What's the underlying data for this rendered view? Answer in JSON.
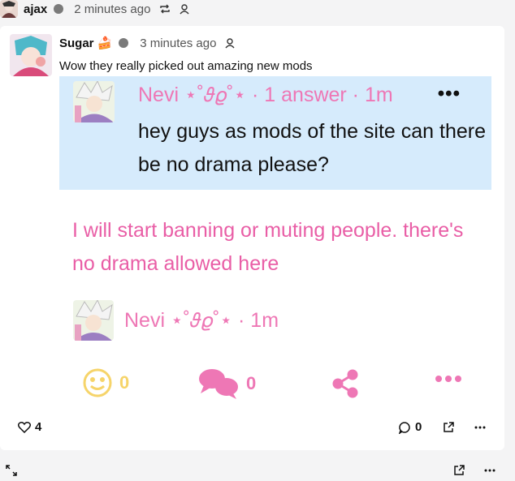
{
  "repost": {
    "author": "ajax",
    "time": "2 minutes ago"
  },
  "post": {
    "author": "Sugar",
    "author_emoji": "🍰",
    "time": "3 minutes ago",
    "text": "Wow they really picked out amazing new mods",
    "likes": "4",
    "comments": "0"
  },
  "embed": {
    "title": "Nevi ⋆˚𝜗𝜚˚⋆ · 1 answer · 1m",
    "question": "hey guys as mods of the site can there be no drama please?",
    "answer": "I will start banning or muting people. there's no drama allowed here",
    "signature": "Nevi ⋆˚𝜗𝜚˚⋆ · 1m",
    "reactions_count": "0",
    "comments_count": "0",
    "accent": "#ee77b5",
    "highlight_bg": "#d6ebfc"
  },
  "icons": [
    "repost-icon",
    "person-icon",
    "more-icon",
    "emoji-smile-icon",
    "comment-bubble-icon",
    "share-icon",
    "heart-icon",
    "comment-icon",
    "external-link-icon",
    "expand-icon"
  ]
}
